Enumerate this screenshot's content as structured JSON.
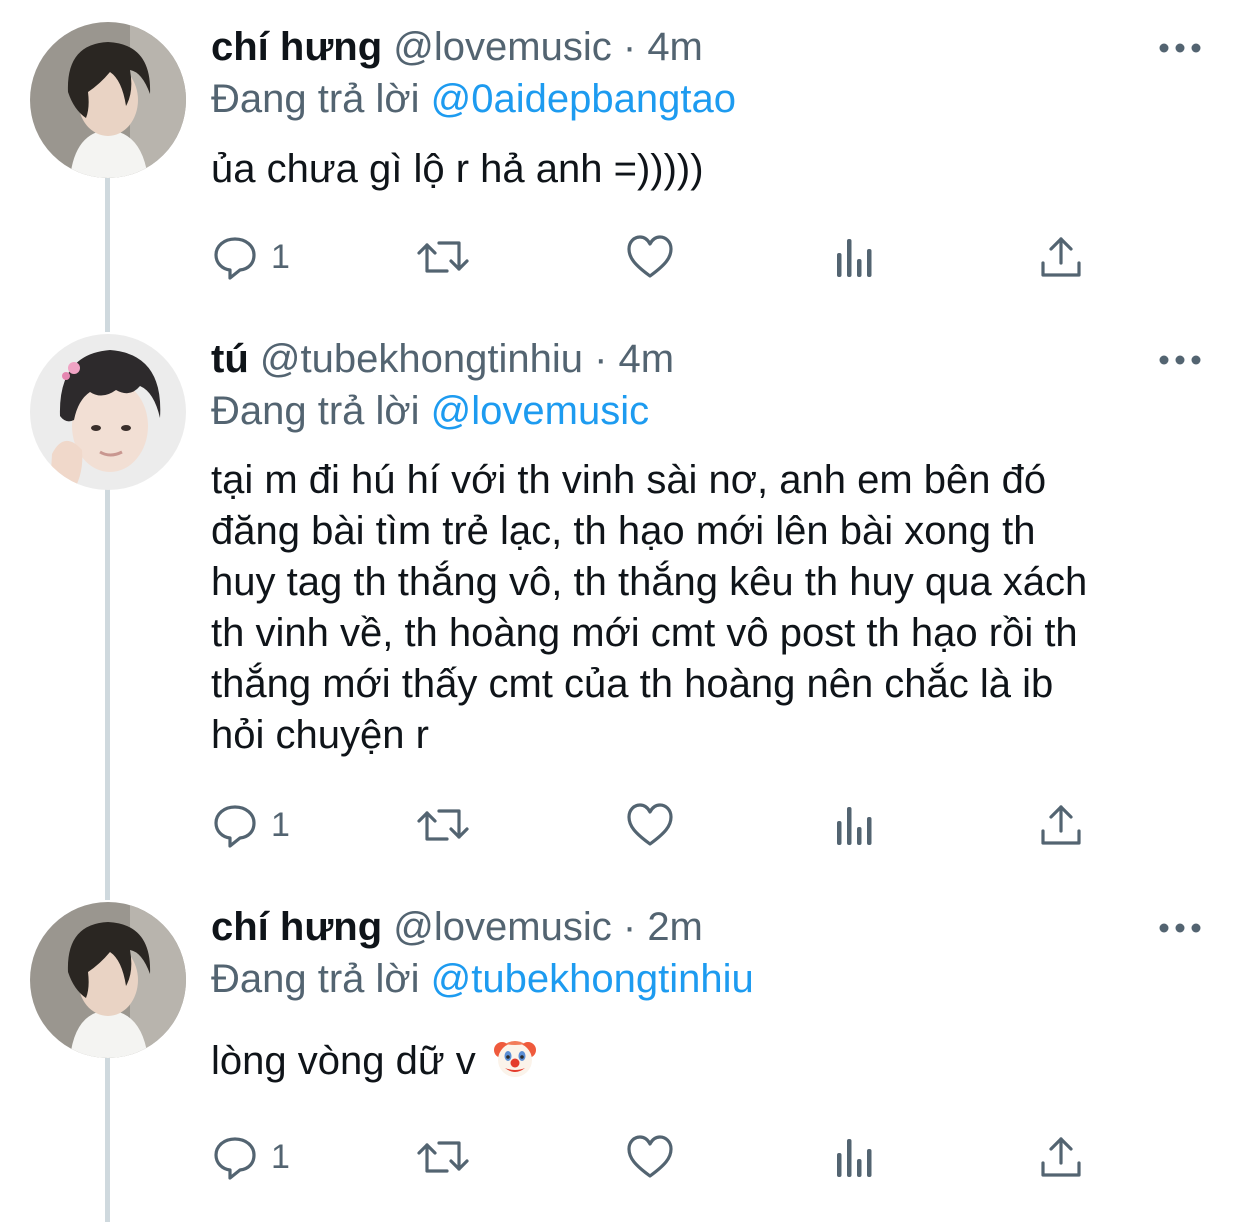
{
  "tweets": [
    {
      "display_name": "chí hưng",
      "handle": "@lovemusic",
      "separator": "·",
      "time": "4m",
      "replying_label": "Đang trả lời",
      "replying_to": "@0aidepbangtao",
      "text": "ủa chưa gì lộ r hả anh =)))))",
      "reply_count": "1",
      "avatar_icon": "profile-photo-avatar"
    },
    {
      "display_name": "tú",
      "handle": "@tubekhongtinhiu",
      "separator": "·",
      "time": "4m",
      "replying_label": "Đang trả lời",
      "replying_to": "@lovemusic",
      "text_lines": [
        "tại m đi hú hí với th vinh sài nơ, anh em bên đó",
        "đăng bài tìm trẻ lạc, th hạo mới lên bài xong th",
        "huy tag th thắng vô, th thắng kêu th huy qua xách",
        "th vinh về, th hoàng mới cmt vô post th hạo rồi th",
        "thắng mới thấy cmt của th hoàng nên chắc là ib",
        "hỏi chuyện r"
      ],
      "reply_count": "1",
      "avatar_icon": "profile-photo-avatar"
    },
    {
      "display_name": "chí hưng",
      "handle": "@lovemusic",
      "separator": "·",
      "time": "2m",
      "replying_label": "Đang trả lời",
      "replying_to": "@tubekhongtinhiu",
      "text": "lòng vòng dữ v",
      "emoji": "clown-face-emoji",
      "reply_count": "1",
      "avatar_icon": "profile-photo-avatar"
    }
  ],
  "colors": {
    "text": "#0f1419",
    "secondary": "#536471",
    "link": "#1d9bf0",
    "thread_line": "#cfd9de"
  },
  "icons": [
    "comment-icon",
    "retweet-icon",
    "like-icon",
    "analytics-icon",
    "share-icon",
    "more-icon"
  ]
}
